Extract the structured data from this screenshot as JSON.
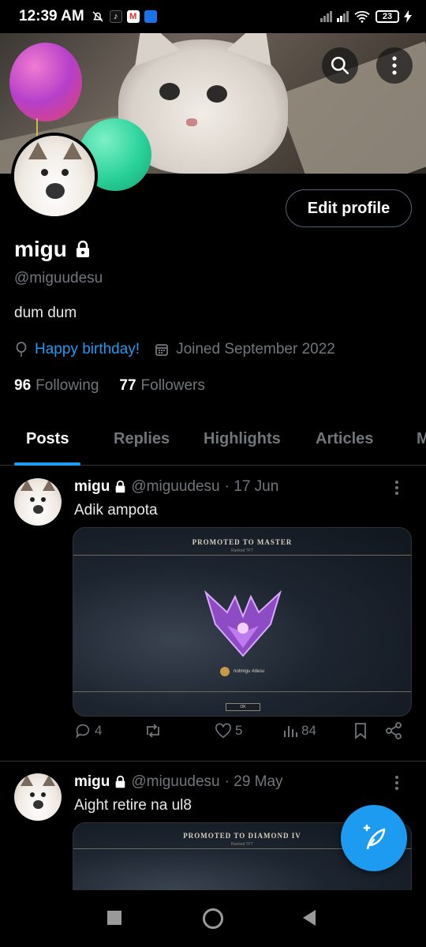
{
  "status_bar": {
    "time": "12:39 AM",
    "battery": "23",
    "icons": [
      "mute-bell-icon",
      "tiktok-icon",
      "gmail-icon",
      "app-icon",
      "signal-icon",
      "wifi-icon",
      "battery-icon",
      "charging-icon"
    ]
  },
  "header": {
    "search_icon": "search-icon",
    "more_icon": "more-vertical-icon"
  },
  "profile": {
    "name": "migu",
    "handle": "@miguudesu",
    "bio": "dum dum",
    "birthday": "Happy birthday!",
    "joined": "Joined September 2022",
    "following_count": "96",
    "following_label": "Following",
    "followers_count": "77",
    "followers_label": "Followers",
    "edit_label": "Edit profile"
  },
  "tabs": [
    "Posts",
    "Replies",
    "Highlights",
    "Articles",
    "M"
  ],
  "active_tab": "Posts",
  "posts": [
    {
      "name": "migu",
      "handle": "@miguudesu",
      "date": "· 17 Jun",
      "text": "Adik ampota",
      "media": {
        "title": "PROMOTED TO MASTER",
        "subtitle": "Ranked TFT",
        "player": "notmigu #desu",
        "ok": "OK"
      },
      "replies": "4",
      "reposts": "",
      "likes": "5",
      "views": "84"
    },
    {
      "name": "migu",
      "handle": "@miguudesu",
      "date": "· 29 May",
      "text": "Aight retire na ul8",
      "media": {
        "title": "PROMOTED TO DIAMOND IV",
        "subtitle": "Ranked TFT"
      }
    }
  ],
  "colors": {
    "accent": "#1d9bf0",
    "muted": "#71767b",
    "border": "#2f3336",
    "background": "#000000"
  }
}
